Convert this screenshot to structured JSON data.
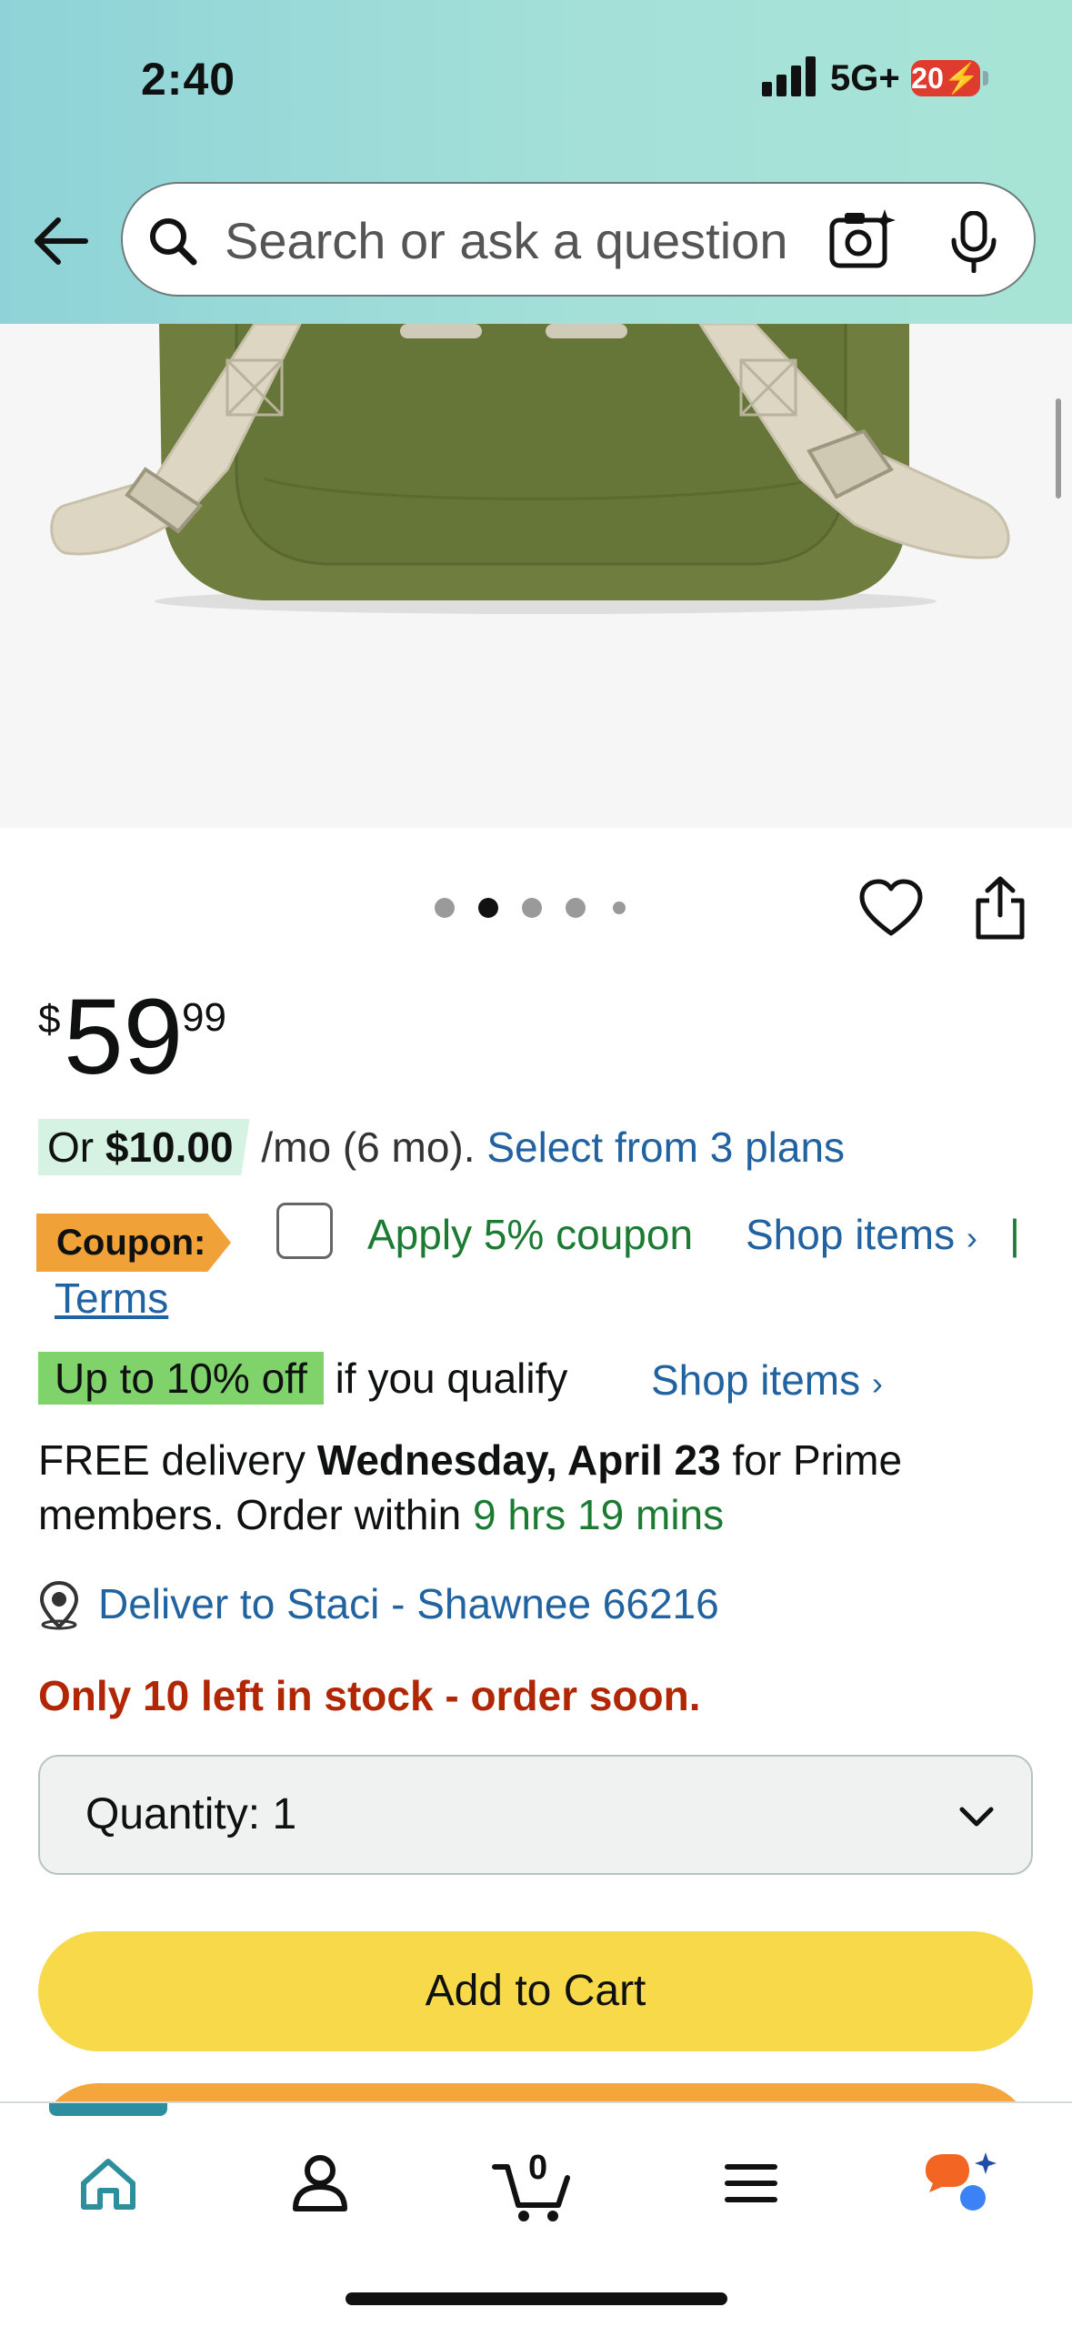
{
  "status_bar": {
    "time": "2:40",
    "network": "5G+",
    "battery": "20"
  },
  "search": {
    "placeholder": "Search or ask a question"
  },
  "gallery": {
    "dot_count": 5,
    "active_index": 1
  },
  "price": {
    "currency": "$",
    "whole": "59",
    "fraction": "99"
  },
  "installment": {
    "prefix": "Or",
    "amount": "$10.00",
    "term": "/mo (6 mo).",
    "plans_link": "Select from 3 plans"
  },
  "coupon": {
    "badge": "Coupon:",
    "apply_label": "Apply 5% coupon",
    "shop_items": "Shop items",
    "separator": "|",
    "terms": "Terms",
    "checked": false
  },
  "deal": {
    "badge": "Up to 10% off",
    "condition": "if you qualify",
    "shop_items": "Shop items"
  },
  "delivery": {
    "prefix": "FREE delivery",
    "date": "Wednesday, April 23",
    "suffix": "for Prime",
    "line2": "members. Order within",
    "countdown": "9 hrs 19 mins"
  },
  "location": {
    "text": "Deliver to Staci - Shawnee 66216"
  },
  "stock": "Only 10 left in stock - order soon.",
  "quantity": {
    "label": "Quantity:",
    "value": "1"
  },
  "add_to_cart": "Add to Cart",
  "nav": {
    "cart_count": "0",
    "active": "home"
  },
  "colors": {
    "accent_link": "#2162a1",
    "add_to_cart": "#f7d94a",
    "buy_now": "#f4a53c",
    "stock": "#b12704",
    "coupon_badge": "#f0a137",
    "deal_badge": "#7fd36a"
  }
}
